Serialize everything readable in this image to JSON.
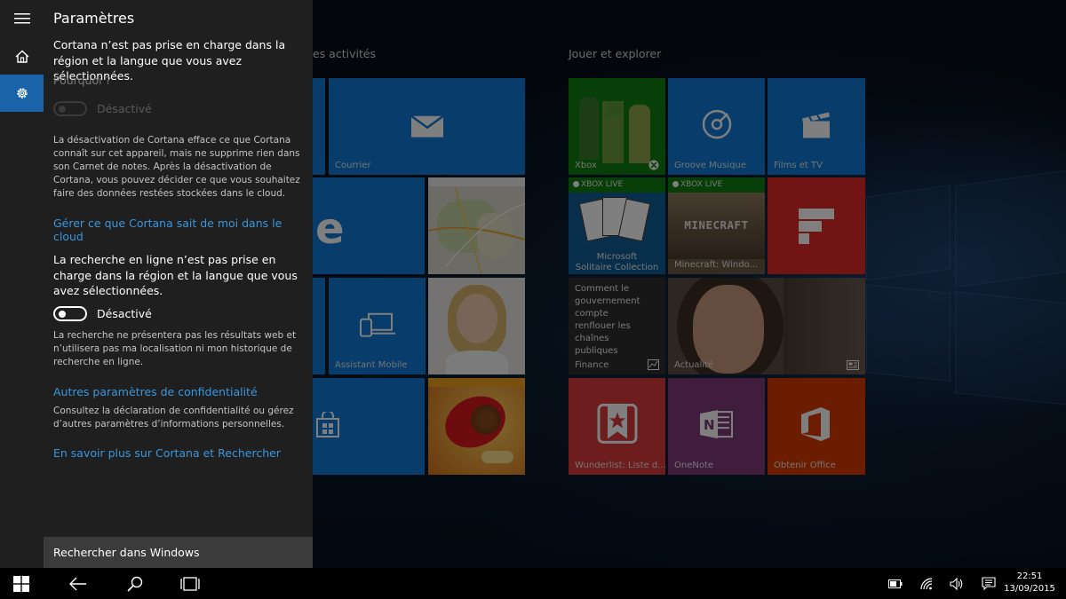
{
  "start": {
    "groups": [
      {
        "label": "es activités"
      },
      {
        "label": "Jouer et explorer"
      }
    ],
    "tiles": {
      "courrier": "Courrier",
      "assistant": "Assistant Mobile",
      "xbox": "Xbox",
      "groove": "Groove Musique",
      "films": "Films et TV",
      "solitaire_badge": "XBOX LIVE",
      "solitaire": "Microsoft\nSolitaire Collection",
      "minecraft_badge": "XBOX LIVE",
      "minecraft_logo": "MINECRAFT",
      "minecraft": "Minecraft: Windo...",
      "finance_text": "Comment le gouvernement compte renflouer les chaînes publiques",
      "finance": "Finance",
      "actualite": "Actualité",
      "wunderlist": "Wunderlist: Liste d...",
      "onenote": "OneNote",
      "office": "Obtenir Office"
    }
  },
  "panel": {
    "title": "Paramètres",
    "unsupported": "Cortana n’est pas prise en charge dans la région et la langue que vous avez sélectionnées.",
    "why": "Pourquoi ?",
    "toggle1_label": "Désactivé",
    "cortana_desc": "La désactivation de Cortana efface ce que Cortana connaît sur cet appareil, mais ne supprime rien dans son Carnet de notes. Après la désactivation de Cortana, vous pouvez décider ce que vous souhaitez faire des données restées stockées dans le cloud.",
    "cloud_link": "Gérer ce que Cortana sait de moi dans le cloud",
    "online_unsupported": "La recherche en ligne n’est pas prise en charge dans la région et la langue que vous avez sélectionnées.",
    "toggle2_label": "Désactivé",
    "online_desc": "La recherche ne présentera pas les résultats web et n’utilisera pas ma localisation ni mon historique de recherche en ligne.",
    "privacy_link": "Autres paramètres de confidentialité",
    "privacy_desc": "Consultez la déclaration de confidentialité ou gérez d’autres paramètres d’informations personnelles.",
    "learn_link": "En savoir plus sur Cortana et Rechercher",
    "search_box": "Rechercher dans Windows"
  },
  "taskbar": {
    "time": "22:51",
    "date": "13/09/2015"
  },
  "colors": {
    "accent": "#1a63a8",
    "link": "#3a96dd",
    "tile_blue": "#0f78d6",
    "xbox_green": "#107c10",
    "flipboard_red": "#e12828",
    "onenote_purple": "#80397b",
    "office_orange": "#d83b01",
    "wunderlist_red": "#da3b3b"
  }
}
